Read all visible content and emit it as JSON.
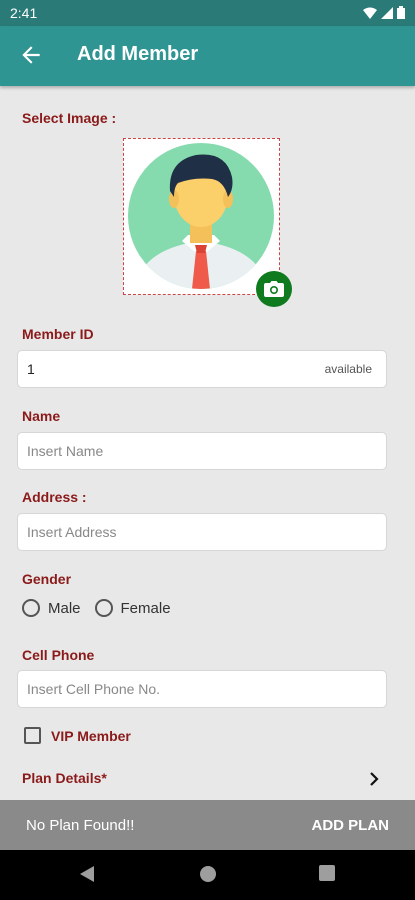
{
  "status_bar": {
    "time": "2:41",
    "icons": [
      "wifi-icon",
      "signal-icon",
      "battery-icon"
    ]
  },
  "app_bar": {
    "title": "Add Member",
    "back_icon": "arrow-left-icon"
  },
  "select_image": {
    "label": "Select Image :",
    "camera_icon": "camera-icon"
  },
  "member_id": {
    "label": "Member ID",
    "value": "1",
    "status": "available"
  },
  "name": {
    "label": "Name",
    "placeholder": "Insert Name"
  },
  "address": {
    "label": "Address :",
    "placeholder": "Insert Address"
  },
  "gender": {
    "label": "Gender",
    "options": [
      "Male",
      "Female"
    ]
  },
  "cell_phone": {
    "label": "Cell Phone",
    "placeholder": "Insert Cell Phone No."
  },
  "vip": {
    "label": "VIP Member",
    "checked": false
  },
  "plan": {
    "label": "Plan Details*",
    "empty_text": "No Plan Found!!",
    "add_label": "ADD PLAN"
  },
  "colors": {
    "accent": "#2f9593",
    "label": "#8b1a1a",
    "camera": "#0f7a1e",
    "bottom_bar": "#8a8a8a"
  }
}
